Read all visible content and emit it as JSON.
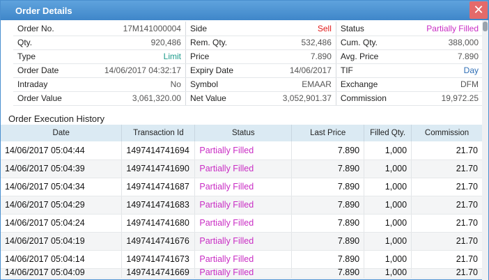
{
  "window": {
    "title": "Order Details",
    "close_label": "✕"
  },
  "details": [
    [
      {
        "label": "Order No.",
        "value": "17M141000004",
        "color": ""
      },
      {
        "label": "Side",
        "value": "Sell",
        "color": "red"
      },
      {
        "label": "Status",
        "value": "Partially Filled",
        "color": "magenta"
      }
    ],
    [
      {
        "label": "Qty.",
        "value": "920,486",
        "color": ""
      },
      {
        "label": "Rem. Qty.",
        "value": "532,486",
        "color": ""
      },
      {
        "label": "Cum. Qty.",
        "value": "388,000",
        "color": ""
      }
    ],
    [
      {
        "label": "Type",
        "value": "Limit",
        "color": "teal"
      },
      {
        "label": "Price",
        "value": "7.890",
        "color": ""
      },
      {
        "label": "Avg. Price",
        "value": "7.890",
        "color": ""
      }
    ],
    [
      {
        "label": "Order Date",
        "value": "14/06/2017 04:32:17",
        "color": ""
      },
      {
        "label": "Expiry Date",
        "value": "14/06/2017",
        "color": ""
      },
      {
        "label": "TIF",
        "value": "Day",
        "color": "blue"
      }
    ],
    [
      {
        "label": "Intraday",
        "value": "No",
        "color": ""
      },
      {
        "label": "Symbol",
        "value": "EMAAR",
        "color": ""
      },
      {
        "label": "Exchange",
        "value": "DFM",
        "color": ""
      }
    ],
    [
      {
        "label": "Order Value",
        "value": "3,061,320.00",
        "color": ""
      },
      {
        "label": "Net Value",
        "value": "3,052,901.37",
        "color": ""
      },
      {
        "label": "Commission",
        "value": "19,972.25",
        "color": ""
      }
    ]
  ],
  "history": {
    "title": "Order Execution History",
    "columns": [
      "Date",
      "Transaction Id",
      "Status",
      "Last Price",
      "Filled Qty.",
      "Commission"
    ],
    "rows": [
      [
        "14/06/2017 05:04:44",
        "1497414741694",
        "Partially Filled",
        "7.890",
        "1,000",
        "21.70"
      ],
      [
        "14/06/2017 05:04:39",
        "1497414741690",
        "Partially Filled",
        "7.890",
        "1,000",
        "21.70"
      ],
      [
        "14/06/2017 05:04:34",
        "1497414741687",
        "Partially Filled",
        "7.890",
        "1,000",
        "21.70"
      ],
      [
        "14/06/2017 05:04:29",
        "1497414741683",
        "Partially Filled",
        "7.890",
        "1,000",
        "21.70"
      ],
      [
        "14/06/2017 05:04:24",
        "1497414741680",
        "Partially Filled",
        "7.890",
        "1,000",
        "21.70"
      ],
      [
        "14/06/2017 05:04:19",
        "1497414741676",
        "Partially Filled",
        "7.890",
        "1,000",
        "21.70"
      ],
      [
        "14/06/2017 05:04:14",
        "1497414741673",
        "Partially Filled",
        "7.890",
        "1,000",
        "21.70"
      ],
      [
        "14/06/2017 05:04:09",
        "1497414741669",
        "Partially Filled",
        "7.890",
        "1,000",
        "21.70"
      ]
    ]
  },
  "colors": {
    "red": "#e01919",
    "magenta": "#c92cc4",
    "teal": "#1a9a8a",
    "blue": "#2f6fb6"
  }
}
